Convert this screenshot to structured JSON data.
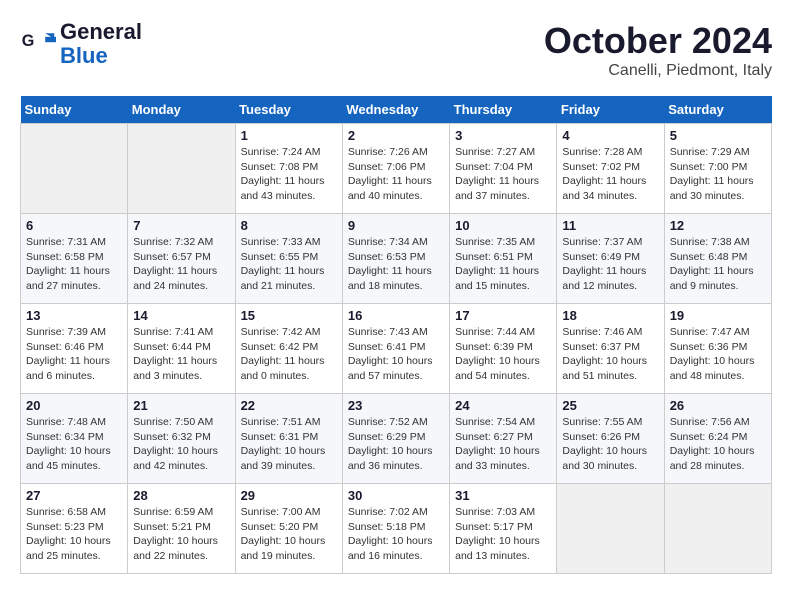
{
  "logo": {
    "line1": "General",
    "line2": "Blue"
  },
  "title": "October 2024",
  "location": "Canelli, Piedmont, Italy",
  "weekdays": [
    "Sunday",
    "Monday",
    "Tuesday",
    "Wednesday",
    "Thursday",
    "Friday",
    "Saturday"
  ],
  "weeks": [
    [
      null,
      null,
      {
        "day": 1,
        "sunrise": "7:24 AM",
        "sunset": "7:08 PM",
        "daylight": "11 hours and 43 minutes."
      },
      {
        "day": 2,
        "sunrise": "7:26 AM",
        "sunset": "7:06 PM",
        "daylight": "11 hours and 40 minutes."
      },
      {
        "day": 3,
        "sunrise": "7:27 AM",
        "sunset": "7:04 PM",
        "daylight": "11 hours and 37 minutes."
      },
      {
        "day": 4,
        "sunrise": "7:28 AM",
        "sunset": "7:02 PM",
        "daylight": "11 hours and 34 minutes."
      },
      {
        "day": 5,
        "sunrise": "7:29 AM",
        "sunset": "7:00 PM",
        "daylight": "11 hours and 30 minutes."
      }
    ],
    [
      {
        "day": 6,
        "sunrise": "7:31 AM",
        "sunset": "6:58 PM",
        "daylight": "11 hours and 27 minutes."
      },
      {
        "day": 7,
        "sunrise": "7:32 AM",
        "sunset": "6:57 PM",
        "daylight": "11 hours and 24 minutes."
      },
      {
        "day": 8,
        "sunrise": "7:33 AM",
        "sunset": "6:55 PM",
        "daylight": "11 hours and 21 minutes."
      },
      {
        "day": 9,
        "sunrise": "7:34 AM",
        "sunset": "6:53 PM",
        "daylight": "11 hours and 18 minutes."
      },
      {
        "day": 10,
        "sunrise": "7:35 AM",
        "sunset": "6:51 PM",
        "daylight": "11 hours and 15 minutes."
      },
      {
        "day": 11,
        "sunrise": "7:37 AM",
        "sunset": "6:49 PM",
        "daylight": "11 hours and 12 minutes."
      },
      {
        "day": 12,
        "sunrise": "7:38 AM",
        "sunset": "6:48 PM",
        "daylight": "11 hours and 9 minutes."
      }
    ],
    [
      {
        "day": 13,
        "sunrise": "7:39 AM",
        "sunset": "6:46 PM",
        "daylight": "11 hours and 6 minutes."
      },
      {
        "day": 14,
        "sunrise": "7:41 AM",
        "sunset": "6:44 PM",
        "daylight": "11 hours and 3 minutes."
      },
      {
        "day": 15,
        "sunrise": "7:42 AM",
        "sunset": "6:42 PM",
        "daylight": "11 hours and 0 minutes."
      },
      {
        "day": 16,
        "sunrise": "7:43 AM",
        "sunset": "6:41 PM",
        "daylight": "10 hours and 57 minutes."
      },
      {
        "day": 17,
        "sunrise": "7:44 AM",
        "sunset": "6:39 PM",
        "daylight": "10 hours and 54 minutes."
      },
      {
        "day": 18,
        "sunrise": "7:46 AM",
        "sunset": "6:37 PM",
        "daylight": "10 hours and 51 minutes."
      },
      {
        "day": 19,
        "sunrise": "7:47 AM",
        "sunset": "6:36 PM",
        "daylight": "10 hours and 48 minutes."
      }
    ],
    [
      {
        "day": 20,
        "sunrise": "7:48 AM",
        "sunset": "6:34 PM",
        "daylight": "10 hours and 45 minutes."
      },
      {
        "day": 21,
        "sunrise": "7:50 AM",
        "sunset": "6:32 PM",
        "daylight": "10 hours and 42 minutes."
      },
      {
        "day": 22,
        "sunrise": "7:51 AM",
        "sunset": "6:31 PM",
        "daylight": "10 hours and 39 minutes."
      },
      {
        "day": 23,
        "sunrise": "7:52 AM",
        "sunset": "6:29 PM",
        "daylight": "10 hours and 36 minutes."
      },
      {
        "day": 24,
        "sunrise": "7:54 AM",
        "sunset": "6:27 PM",
        "daylight": "10 hours and 33 minutes."
      },
      {
        "day": 25,
        "sunrise": "7:55 AM",
        "sunset": "6:26 PM",
        "daylight": "10 hours and 30 minutes."
      },
      {
        "day": 26,
        "sunrise": "7:56 AM",
        "sunset": "6:24 PM",
        "daylight": "10 hours and 28 minutes."
      }
    ],
    [
      {
        "day": 27,
        "sunrise": "6:58 AM",
        "sunset": "5:23 PM",
        "daylight": "10 hours and 25 minutes."
      },
      {
        "day": 28,
        "sunrise": "6:59 AM",
        "sunset": "5:21 PM",
        "daylight": "10 hours and 22 minutes."
      },
      {
        "day": 29,
        "sunrise": "7:00 AM",
        "sunset": "5:20 PM",
        "daylight": "10 hours and 19 minutes."
      },
      {
        "day": 30,
        "sunrise": "7:02 AM",
        "sunset": "5:18 PM",
        "daylight": "10 hours and 16 minutes."
      },
      {
        "day": 31,
        "sunrise": "7:03 AM",
        "sunset": "5:17 PM",
        "daylight": "10 hours and 13 minutes."
      },
      null,
      null
    ]
  ]
}
